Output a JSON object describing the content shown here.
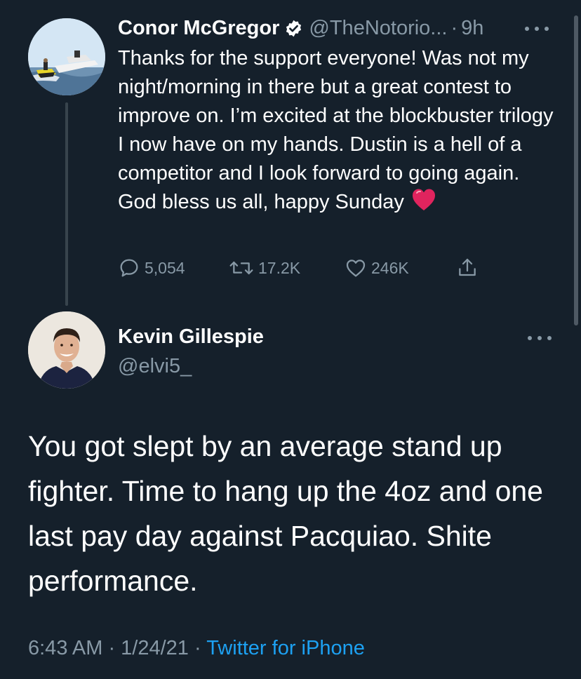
{
  "parent_tweet": {
    "name": "Conor McGregor",
    "handle": "@TheNotorio...",
    "separator": "·",
    "time": "9h",
    "text": "Thanks for the support everyone! Was not my night/morning in there but a great contest to improve on. I’m excited at the blockbuster trilogy I now have on my hands. Dustin is a hell of a competitor and I look forward to going again. God bless us all, happy Sunday",
    "verified_icon": "verified-badge-icon",
    "emoji": "red-heart-emoji",
    "stats": {
      "replies": "5,054",
      "retweets": "17.2K",
      "likes": "246K"
    }
  },
  "reply_tweet": {
    "name": "Kevin Gillespie",
    "handle": "@elvi5_",
    "text": "You got slept by an average stand up fighter. Time to hang up the 4oz and one last pay day against Pacquiao. Shite performance.",
    "timestamp": "6:43 AM · 1/24/21 · ",
    "source": "Twitter for iPhone"
  },
  "colors": {
    "background": "#15202b",
    "secondary_text": "#8899a6",
    "accent": "#1da1f2",
    "verified": "#ffffff",
    "heart": "#e0245e"
  }
}
